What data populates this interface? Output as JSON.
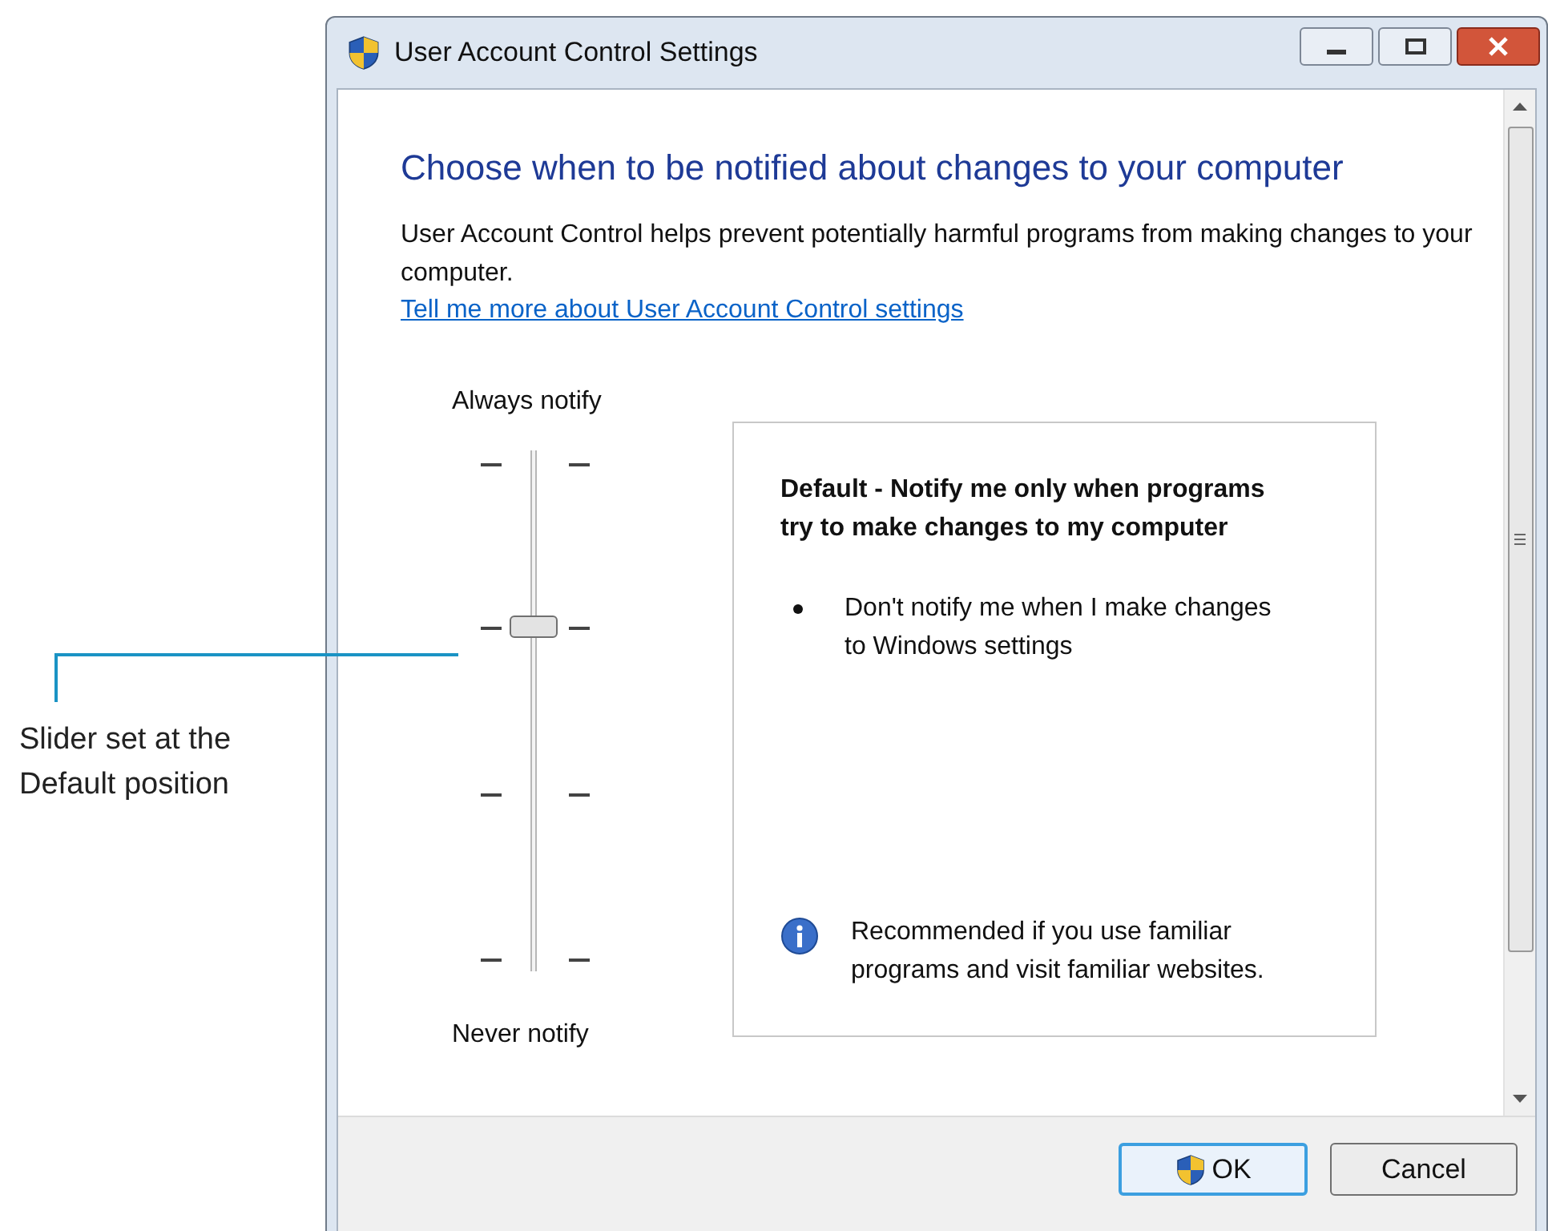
{
  "annotation": {
    "text": "Slider set at the Default position"
  },
  "window": {
    "title": "User Account Control Settings"
  },
  "heading": "Choose when to be notified about changes to your computer",
  "description": "User Account Control helps prevent potentially harmful programs from making changes to your computer.",
  "link": "Tell me more about User Account Control settings",
  "slider": {
    "top_label": "Always notify",
    "bottom_label": "Never notify",
    "level": 0.67
  },
  "info_panel": {
    "title": "Default - Notify me only when programs try to make changes to my computer",
    "bullets": [
      "Don't notify me when I make changes to Windows settings"
    ],
    "note": "Recommended if you use familiar programs and visit familiar websites."
  },
  "buttons": [
    {
      "label": "OK",
      "kind": "shield"
    },
    {
      "label": "Cancel",
      "kind": "plain"
    }
  ]
}
